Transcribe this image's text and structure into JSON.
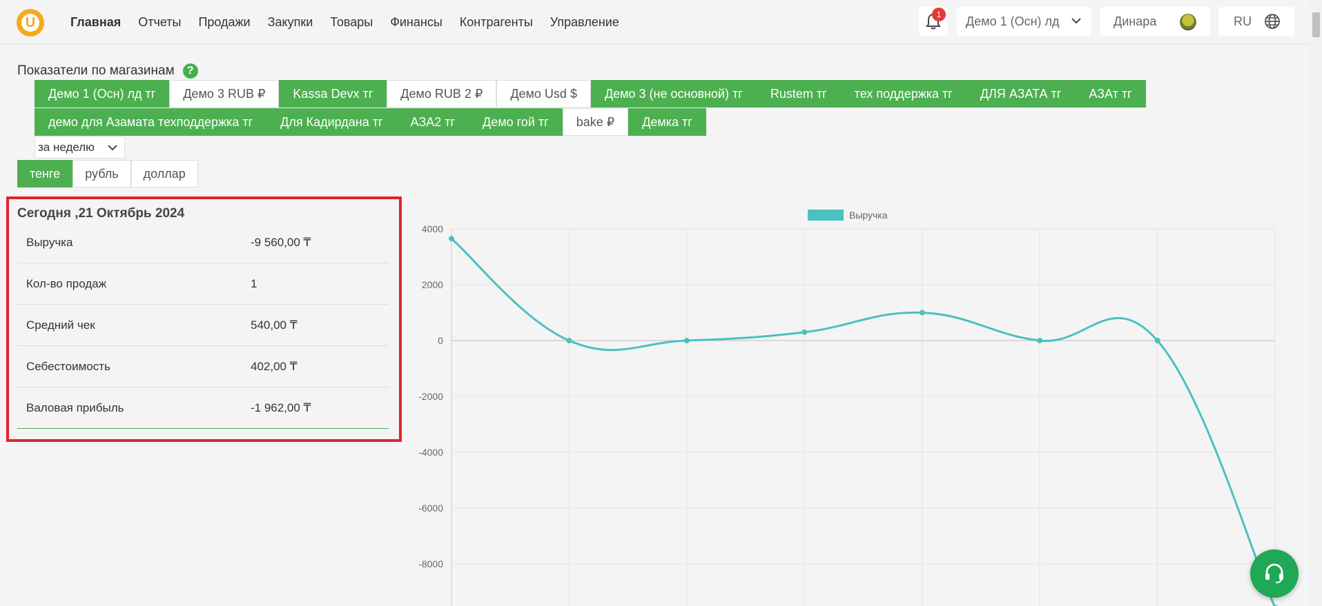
{
  "nav": {
    "items": [
      "Главная",
      "Отчеты",
      "Продажи",
      "Закупки",
      "Товары",
      "Финансы",
      "Контрагенты",
      "Управление"
    ],
    "active_index": 0
  },
  "header": {
    "notifications_count": "1",
    "store_selector": "Демо 1 (Осн) лд",
    "user_name": "Динара",
    "language": "RU"
  },
  "section_title": "Показатели по магазинам",
  "stores_row1": [
    {
      "label": "Демо 1 (Осн) лд тг",
      "selected": true
    },
    {
      "label": "Демо 3 RUB ₽",
      "selected": false
    },
    {
      "label": "Kassa Devx тг",
      "selected": true
    },
    {
      "label": "Демо RUB 2 ₽",
      "selected": false
    },
    {
      "label": "Демо Usd $",
      "selected": false
    },
    {
      "label": "Демо 3 (не основной) тг",
      "selected": true
    },
    {
      "label": "Rustem тг",
      "selected": true
    },
    {
      "label": "тех поддержка тг",
      "selected": true
    },
    {
      "label": "ДЛЯ АЗАТА тг",
      "selected": true
    },
    {
      "label": "АЗАт тг",
      "selected": true
    }
  ],
  "stores_row2": [
    {
      "label": "демо для Азамата техподдержка тг",
      "selected": true
    },
    {
      "label": "Для Кадирдана тг",
      "selected": true
    },
    {
      "label": "АЗА2 тг",
      "selected": true
    },
    {
      "label": "Демо гой тг",
      "selected": true
    },
    {
      "label": "bake ₽",
      "selected": false
    },
    {
      "label": "Демка тг",
      "selected": true
    }
  ],
  "period": "за неделю",
  "currencies": [
    {
      "label": "тенге",
      "selected": true
    },
    {
      "label": "рубль",
      "selected": false
    },
    {
      "label": "доллар",
      "selected": false
    }
  ],
  "stats": {
    "title": "Сегодня ,21 Октябрь 2024",
    "rows": [
      {
        "label": "Выручка",
        "value": "-9 560,00 ₸"
      },
      {
        "label": "Кол-во продаж",
        "value": "1"
      },
      {
        "label": "Средний чек",
        "value": "540,00 ₸"
      },
      {
        "label": "Себестоимость",
        "value": "402,00 ₸"
      },
      {
        "label": "Валовая прибыль",
        "value": "-1 962,00 ₸"
      }
    ]
  },
  "colors": {
    "accent_green": "#4caf50",
    "highlight_red": "#e0232b",
    "series": "#4bc0c0"
  },
  "chart_data": {
    "type": "line",
    "series": [
      {
        "name": "Выручка",
        "values": [
          3650,
          0,
          0,
          300,
          1000,
          0,
          0,
          -9560
        ]
      }
    ],
    "ylim": [
      -9560,
      4000
    ],
    "yticks": [
      4000,
      2000,
      0,
      -2000,
      -4000,
      -6000,
      -8000
    ],
    "grid": true,
    "legend": "top"
  },
  "icons": {
    "bell": "bell-icon",
    "store_chevron": "chevron-down-icon",
    "language": "globe-icon",
    "help": "question-icon",
    "support": "headset-icon"
  }
}
